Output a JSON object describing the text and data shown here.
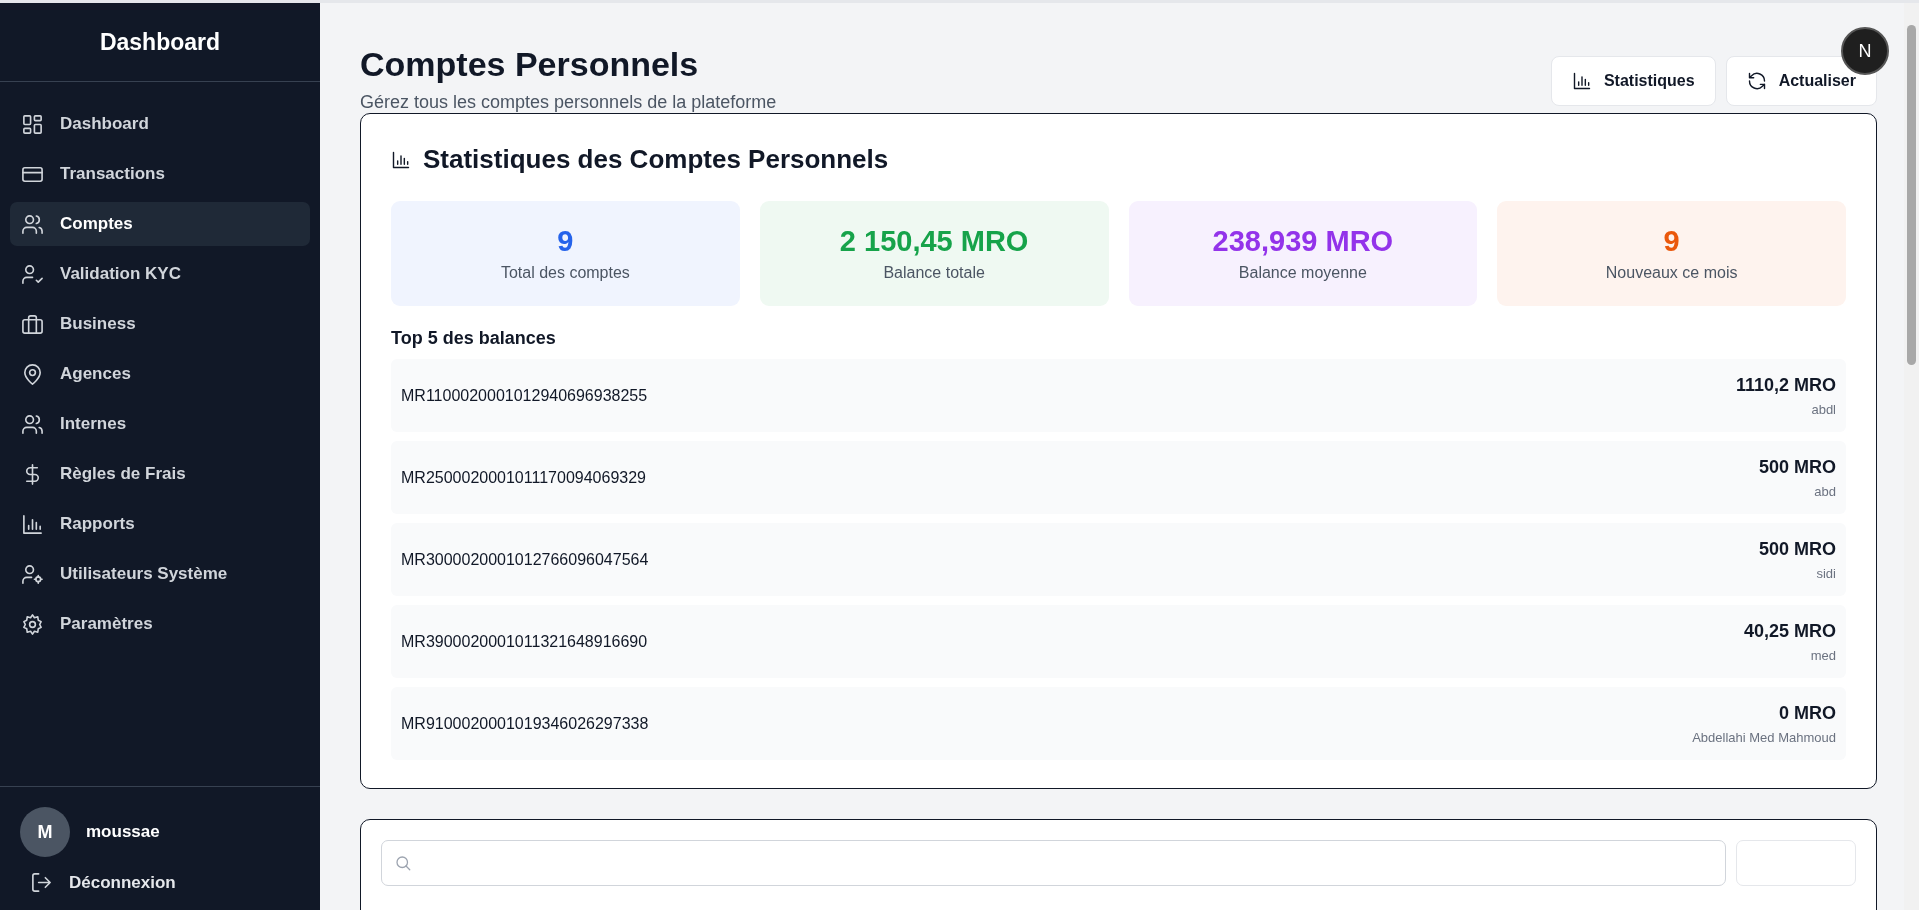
{
  "sidebar": {
    "title": "Dashboard",
    "items": [
      {
        "label": "Dashboard",
        "selected": false
      },
      {
        "label": "Transactions",
        "selected": false
      },
      {
        "label": "Comptes",
        "selected": true
      },
      {
        "label": "Validation KYC",
        "selected": false
      },
      {
        "label": "Business",
        "selected": false
      },
      {
        "label": "Agences",
        "selected": false
      },
      {
        "label": "Internes",
        "selected": false
      },
      {
        "label": "Règles de Frais",
        "selected": false
      },
      {
        "label": "Rapports",
        "selected": false
      },
      {
        "label": "Utilisateurs Système",
        "selected": false
      },
      {
        "label": "Paramètres",
        "selected": false
      }
    ],
    "user": {
      "initial": "M",
      "name": "moussae"
    },
    "logout": {
      "label": "Déconnexion"
    }
  },
  "header": {
    "title": "Comptes Personnels",
    "subtitle": "Gérez tous les comptes personnels de la plateforme",
    "buttons": [
      {
        "label": "Statistiques"
      },
      {
        "label": "Actualiser"
      }
    ]
  },
  "corner_avatar": {
    "initial": "N"
  },
  "stats": {
    "title": "Statistiques des Comptes Personnels",
    "tiles": [
      {
        "value": "9",
        "label": "Total des comptes",
        "color": "#2563eb"
      },
      {
        "value": "2 150,45 MRO",
        "label": "Balance totale",
        "color": "#16a34a"
      },
      {
        "value": "238,939 MRO",
        "label": "Balance moyenne",
        "color": "#9333ea"
      },
      {
        "value": "9",
        "label": "Nouveaux ce mois",
        "color": "#ea580c"
      }
    ],
    "top_title": "Top 5 des balances",
    "top_rows": [
      {
        "account": "MR1100020001012940696938255",
        "amount": "1110,2 MRO",
        "owner": "abdl"
      },
      {
        "account": "MR2500020001011170094069329",
        "amount": "500 MRO",
        "owner": "abd"
      },
      {
        "account": "MR3000020001012766096047564",
        "amount": "500 MRO",
        "owner": "sidi"
      },
      {
        "account": "MR3900020001011321648916690",
        "amount": "40,25 MRO",
        "owner": "med"
      },
      {
        "account": "MR9100020001019346026297338",
        "amount": "0 MRO",
        "owner": "Abdellahi Med Mahmoud"
      }
    ]
  }
}
